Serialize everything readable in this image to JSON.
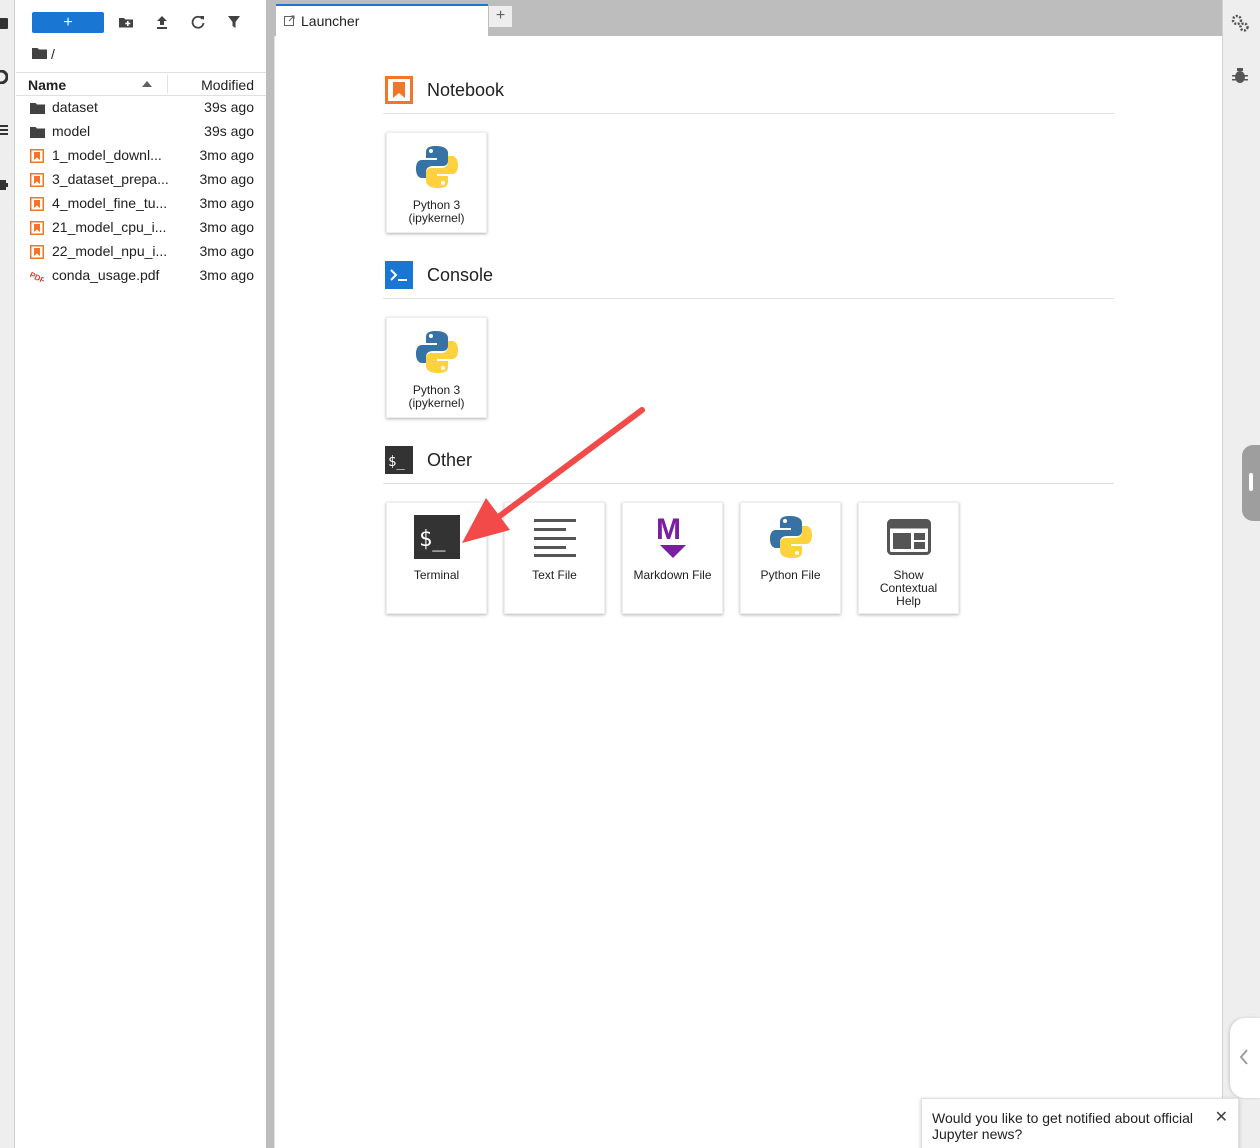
{
  "toolbar": {
    "new_launcher_label": "+",
    "new_folder_icon": "new-folder-icon",
    "upload_icon": "upload-icon",
    "refresh_icon": "refresh-icon",
    "filter_icon": "filter-icon"
  },
  "breadcrumb": {
    "path": "/"
  },
  "file_browser": {
    "columns": {
      "name": "Name",
      "modified": "Modified"
    },
    "items": [
      {
        "name": "dataset",
        "modified": "39s ago",
        "type": "folder"
      },
      {
        "name": "model",
        "modified": "39s ago",
        "type": "folder"
      },
      {
        "name": "1_model_downl...",
        "modified": "3mo ago",
        "type": "notebook"
      },
      {
        "name": "3_dataset_prepa...",
        "modified": "3mo ago",
        "type": "notebook"
      },
      {
        "name": "4_model_fine_tu...",
        "modified": "3mo ago",
        "type": "notebook"
      },
      {
        "name": "21_model_cpu_i...",
        "modified": "3mo ago",
        "type": "notebook"
      },
      {
        "name": "22_model_npu_i...",
        "modified": "3mo ago",
        "type": "notebook"
      },
      {
        "name": "conda_usage.pdf",
        "modified": "3mo ago",
        "type": "pdf"
      }
    ]
  },
  "tabs": {
    "active_label": "Launcher",
    "add_label": "+"
  },
  "launcher": {
    "sections": {
      "notebook": {
        "title": "Notebook",
        "cards": [
          {
            "label_line1": "Python 3",
            "label_line2": "(ipykernel)"
          }
        ]
      },
      "console": {
        "title": "Console",
        "cards": [
          {
            "label_line1": "Python 3",
            "label_line2": "(ipykernel)"
          }
        ]
      },
      "other": {
        "title": "Other",
        "cards": [
          {
            "label": "Terminal"
          },
          {
            "label": "Text File"
          },
          {
            "label": "Markdown File"
          },
          {
            "label": "Python File"
          },
          {
            "label_line1": "Show",
            "label_line2": "Contextual",
            "label_line3": "Help"
          }
        ]
      }
    }
  },
  "toast": {
    "message": "Would you like to get notified about official Jupyter news?",
    "close_label": "✕"
  },
  "colors": {
    "accent": "#1976d2",
    "notebook_orange": "#f37626",
    "arrow_red": "#f24949",
    "markdown_purple": "#7b1fa2"
  }
}
